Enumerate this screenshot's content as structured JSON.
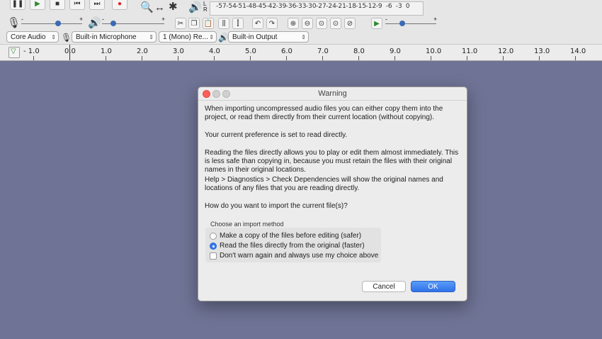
{
  "toolbar": {
    "meter_ticks": [
      "-57",
      "-54",
      "-51",
      "-48",
      "-45",
      "-42",
      "-39",
      "-36",
      "-33",
      "-30",
      "-27",
      "-24",
      "-21",
      "-18",
      "-15",
      "-12",
      "-9",
      "-6",
      "-3",
      "0"
    ],
    "meter_lr": [
      "L",
      "R"
    ],
    "audio_host": "Core Audio",
    "recording_device": "Built-in Microphone",
    "recording_channels": "1 (Mono) Re...",
    "playback_device": "Built-in Output",
    "slider_minus": "-",
    "slider_plus": "+"
  },
  "ruler": {
    "labels": [
      "- 1.0",
      "0.0",
      "1.0",
      "2.0",
      "3.0",
      "4.0",
      "5.0",
      "6.0",
      "7.0",
      "8.0",
      "9.0",
      "10.0",
      "11.0",
      "12.0",
      "13.0",
      "14.0"
    ]
  },
  "dialog": {
    "title": "Warning",
    "p1": "When importing uncompressed audio files you can either copy them into the project, or read them directly from their current location (without copying).",
    "p2": "Your current preference is set to read directly.",
    "p3": "Reading the files directly allows you to play or edit them almost immediately.  This is less safe than copying in, because you must retain the files with their original names in their original locations.",
    "p4": "Help > Diagnostics > Check Dependencies will show the original names and locations of any files that you are reading directly.",
    "p5": "How do you want to import the current file(s)?",
    "group_label": "Choose an import method",
    "option_copy": "Make a copy of the files before editing (safer)",
    "option_read": "Read the files directly from the original (faster)",
    "option_dont_warn": "Don't warn again and always use my choice above",
    "selected_option": "option_read",
    "cancel_label": "Cancel",
    "ok_label": "OK"
  }
}
